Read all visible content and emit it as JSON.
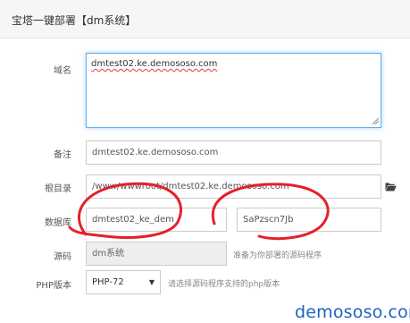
{
  "dialog": {
    "title": "宝塔一键部署【dm系统】"
  },
  "form": {
    "domain": {
      "label": "域名",
      "value": "dmtest02.ke.demososo.com"
    },
    "remark": {
      "label": "备注",
      "value": "dmtest02.ke.demososo.com"
    },
    "root": {
      "label": "根目录",
      "value": "/www/wwwroot/dmtest02.ke.demososo.com",
      "icon": "folder-open-icon"
    },
    "database": {
      "label": "数据库",
      "name_value": "dmtest02_ke_dem",
      "password_value": "SaPzscn7Jb"
    },
    "source": {
      "label": "源码",
      "value": "dm系统",
      "hint": "准备为你部署的源码程序"
    },
    "php": {
      "label": "PHP版本",
      "selected": "PHP-72",
      "hint": "请选择源码程序支持的php版本"
    }
  },
  "watermark": {
    "text": "demososo.com"
  },
  "colors": {
    "focus": "#66afe9",
    "annotation": "#e5202a",
    "watermark": "#1e63c7"
  }
}
